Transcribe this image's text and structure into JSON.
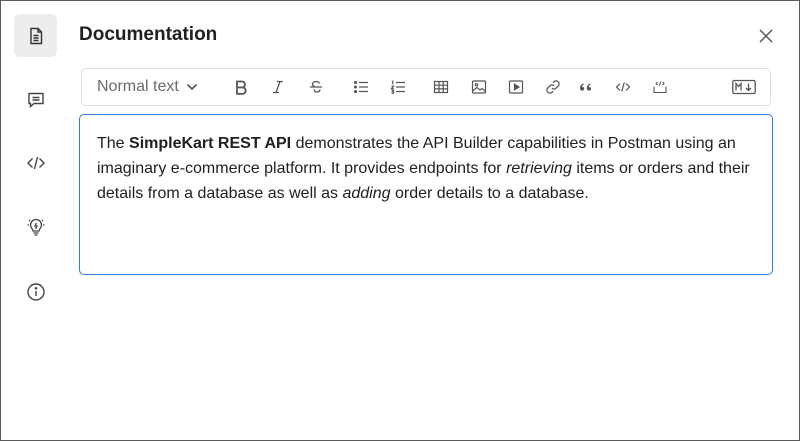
{
  "panel": {
    "title": "Documentation"
  },
  "rail": {
    "items": [
      {
        "name": "documentation",
        "icon": "document-icon",
        "active": true
      },
      {
        "name": "comments",
        "icon": "comment-icon",
        "active": false
      },
      {
        "name": "code",
        "icon": "code-icon",
        "active": false
      },
      {
        "name": "suggestions",
        "icon": "lightbulb-icon",
        "active": false
      },
      {
        "name": "info",
        "icon": "info-icon",
        "active": false
      }
    ]
  },
  "toolbar": {
    "text_style": "Normal text",
    "buttons": [
      "bold-icon",
      "italic-icon",
      "strikethrough-icon",
      "bulleted-list-icon",
      "numbered-list-icon",
      "table-icon",
      "image-icon",
      "video-icon",
      "link-icon",
      "quote-icon",
      "inline-code-icon",
      "code-block-icon",
      "markdown-icon"
    ]
  },
  "editor": {
    "seg1": "The ",
    "seg2": "SimpleKart REST API",
    "seg3": " demonstrates the API Builder capabilities in Postman using an imaginary e-commerce platform. It provides endpoints for ",
    "seg4": "retrieving",
    "seg5": " items or orders and their details from a database as well as ",
    "seg6": "adding",
    "seg7": " order details to a database."
  },
  "colors": {
    "focus_border": "#2f7fd8",
    "active_rail_bg": "#ededed"
  }
}
